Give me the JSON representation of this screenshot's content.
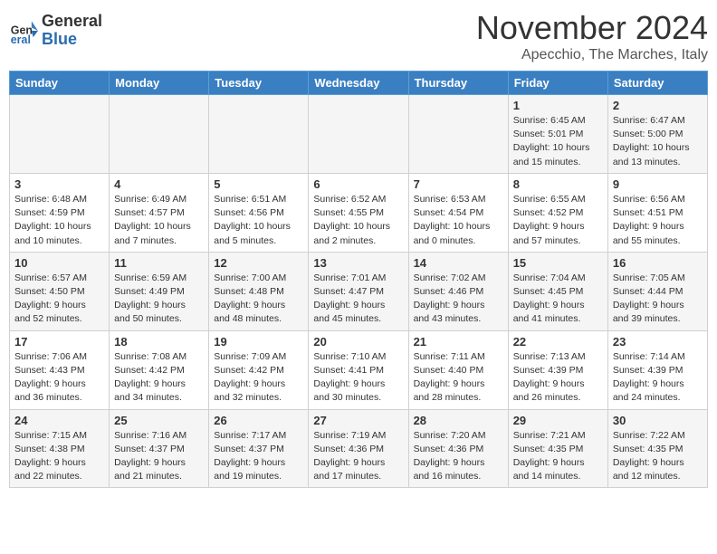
{
  "header": {
    "logo_general": "General",
    "logo_blue": "Blue",
    "month_title": "November 2024",
    "location": "Apecchio, The Marches, Italy"
  },
  "weekdays": [
    "Sunday",
    "Monday",
    "Tuesday",
    "Wednesday",
    "Thursday",
    "Friday",
    "Saturday"
  ],
  "weeks": [
    [
      {
        "day": "",
        "info": ""
      },
      {
        "day": "",
        "info": ""
      },
      {
        "day": "",
        "info": ""
      },
      {
        "day": "",
        "info": ""
      },
      {
        "day": "",
        "info": ""
      },
      {
        "day": "1",
        "info": "Sunrise: 6:45 AM\nSunset: 5:01 PM\nDaylight: 10 hours\nand 15 minutes."
      },
      {
        "day": "2",
        "info": "Sunrise: 6:47 AM\nSunset: 5:00 PM\nDaylight: 10 hours\nand 13 minutes."
      }
    ],
    [
      {
        "day": "3",
        "info": "Sunrise: 6:48 AM\nSunset: 4:59 PM\nDaylight: 10 hours\nand 10 minutes."
      },
      {
        "day": "4",
        "info": "Sunrise: 6:49 AM\nSunset: 4:57 PM\nDaylight: 10 hours\nand 7 minutes."
      },
      {
        "day": "5",
        "info": "Sunrise: 6:51 AM\nSunset: 4:56 PM\nDaylight: 10 hours\nand 5 minutes."
      },
      {
        "day": "6",
        "info": "Sunrise: 6:52 AM\nSunset: 4:55 PM\nDaylight: 10 hours\nand 2 minutes."
      },
      {
        "day": "7",
        "info": "Sunrise: 6:53 AM\nSunset: 4:54 PM\nDaylight: 10 hours\nand 0 minutes."
      },
      {
        "day": "8",
        "info": "Sunrise: 6:55 AM\nSunset: 4:52 PM\nDaylight: 9 hours\nand 57 minutes."
      },
      {
        "day": "9",
        "info": "Sunrise: 6:56 AM\nSunset: 4:51 PM\nDaylight: 9 hours\nand 55 minutes."
      }
    ],
    [
      {
        "day": "10",
        "info": "Sunrise: 6:57 AM\nSunset: 4:50 PM\nDaylight: 9 hours\nand 52 minutes."
      },
      {
        "day": "11",
        "info": "Sunrise: 6:59 AM\nSunset: 4:49 PM\nDaylight: 9 hours\nand 50 minutes."
      },
      {
        "day": "12",
        "info": "Sunrise: 7:00 AM\nSunset: 4:48 PM\nDaylight: 9 hours\nand 48 minutes."
      },
      {
        "day": "13",
        "info": "Sunrise: 7:01 AM\nSunset: 4:47 PM\nDaylight: 9 hours\nand 45 minutes."
      },
      {
        "day": "14",
        "info": "Sunrise: 7:02 AM\nSunset: 4:46 PM\nDaylight: 9 hours\nand 43 minutes."
      },
      {
        "day": "15",
        "info": "Sunrise: 7:04 AM\nSunset: 4:45 PM\nDaylight: 9 hours\nand 41 minutes."
      },
      {
        "day": "16",
        "info": "Sunrise: 7:05 AM\nSunset: 4:44 PM\nDaylight: 9 hours\nand 39 minutes."
      }
    ],
    [
      {
        "day": "17",
        "info": "Sunrise: 7:06 AM\nSunset: 4:43 PM\nDaylight: 9 hours\nand 36 minutes."
      },
      {
        "day": "18",
        "info": "Sunrise: 7:08 AM\nSunset: 4:42 PM\nDaylight: 9 hours\nand 34 minutes."
      },
      {
        "day": "19",
        "info": "Sunrise: 7:09 AM\nSunset: 4:42 PM\nDaylight: 9 hours\nand 32 minutes."
      },
      {
        "day": "20",
        "info": "Sunrise: 7:10 AM\nSunset: 4:41 PM\nDaylight: 9 hours\nand 30 minutes."
      },
      {
        "day": "21",
        "info": "Sunrise: 7:11 AM\nSunset: 4:40 PM\nDaylight: 9 hours\nand 28 minutes."
      },
      {
        "day": "22",
        "info": "Sunrise: 7:13 AM\nSunset: 4:39 PM\nDaylight: 9 hours\nand 26 minutes."
      },
      {
        "day": "23",
        "info": "Sunrise: 7:14 AM\nSunset: 4:39 PM\nDaylight: 9 hours\nand 24 minutes."
      }
    ],
    [
      {
        "day": "24",
        "info": "Sunrise: 7:15 AM\nSunset: 4:38 PM\nDaylight: 9 hours\nand 22 minutes."
      },
      {
        "day": "25",
        "info": "Sunrise: 7:16 AM\nSunset: 4:37 PM\nDaylight: 9 hours\nand 21 minutes."
      },
      {
        "day": "26",
        "info": "Sunrise: 7:17 AM\nSunset: 4:37 PM\nDaylight: 9 hours\nand 19 minutes."
      },
      {
        "day": "27",
        "info": "Sunrise: 7:19 AM\nSunset: 4:36 PM\nDaylight: 9 hours\nand 17 minutes."
      },
      {
        "day": "28",
        "info": "Sunrise: 7:20 AM\nSunset: 4:36 PM\nDaylight: 9 hours\nand 16 minutes."
      },
      {
        "day": "29",
        "info": "Sunrise: 7:21 AM\nSunset: 4:35 PM\nDaylight: 9 hours\nand 14 minutes."
      },
      {
        "day": "30",
        "info": "Sunrise: 7:22 AM\nSunset: 4:35 PM\nDaylight: 9 hours\nand 12 minutes."
      }
    ]
  ]
}
